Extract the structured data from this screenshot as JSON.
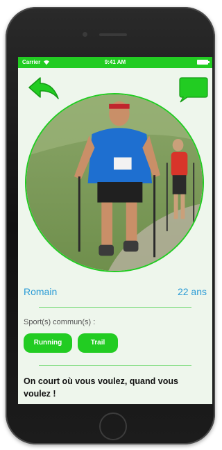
{
  "status_bar": {
    "carrier": "Carrier",
    "time": "9:41 AM",
    "wifi_icon": "wifi-icon",
    "battery_icon": "battery-icon"
  },
  "header": {
    "back_icon": "back-arrow-icon",
    "chat_icon": "chat-bubble-icon"
  },
  "profile": {
    "name": "Romain",
    "age": "22 ans"
  },
  "sports": {
    "label": "Sport(s) commun(s) :",
    "items": [
      "Running",
      "Trail"
    ]
  },
  "slogan": "On court où vous voulez, quand vous voulez !",
  "colors": {
    "accent": "#22cc22",
    "name_blue": "#2a9bd6",
    "background": "#eef6ec"
  }
}
